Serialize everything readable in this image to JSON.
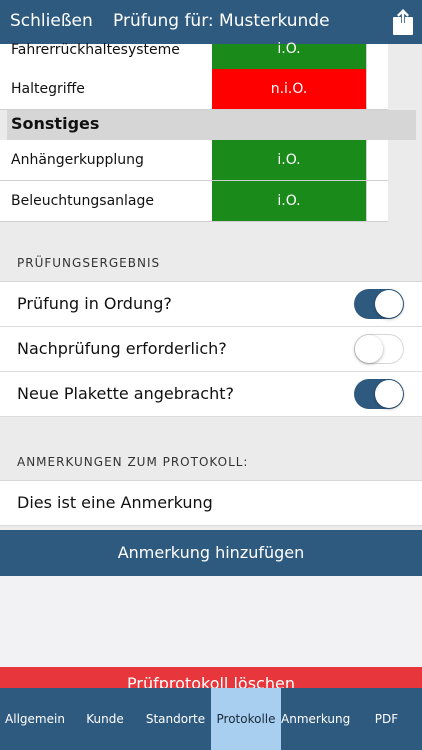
{
  "header": {
    "close_label": "Schließen",
    "title": "Prüfung für: Musterkunde",
    "share_icon": "share-icon"
  },
  "colors": {
    "brand": "#2e5a80",
    "ok": "#1a8a1a",
    "not_ok": "#ff0000",
    "delete": "#e8373c",
    "tab_active": "#a8cff0"
  },
  "checks": {
    "rows_top": [
      {
        "label": "Fahrerrückhaltesysteme",
        "status": "i.O.",
        "state": "ok"
      },
      {
        "label": "Haltegriffe",
        "status": "n.i.O.",
        "state": "not_ok"
      }
    ],
    "section_other": "Sonstiges",
    "rows_other": [
      {
        "label": "Anhängerkupplung",
        "status": "i.O.",
        "state": "ok"
      },
      {
        "label": "Beleuchtungsanlage",
        "status": "i.O.",
        "state": "ok"
      }
    ]
  },
  "result": {
    "header": "PRÜFUNGSERGEBNIS",
    "items": [
      {
        "label": "Prüfung in Ordung?",
        "on": true
      },
      {
        "label": "Nachprüfung erforderlich?",
        "on": false
      },
      {
        "label": "Neue Plakette angebracht?",
        "on": true
      }
    ]
  },
  "notes": {
    "header": "ANMERKUNGEN ZUM PROTOKOLL:",
    "items": [
      "Dies ist eine Anmerkung"
    ],
    "add_label": "Anmerkung hinzufügen"
  },
  "delete_label": "Prüfprotokoll löschen",
  "tabs": [
    {
      "label": "Allgemein",
      "active": false
    },
    {
      "label": "Kunde",
      "active": false
    },
    {
      "label": "Standorte",
      "active": false
    },
    {
      "label": "Protokolle",
      "active": true
    },
    {
      "label": "Anmerkungen",
      "active": false
    },
    {
      "label": "PDF",
      "active": false
    }
  ]
}
